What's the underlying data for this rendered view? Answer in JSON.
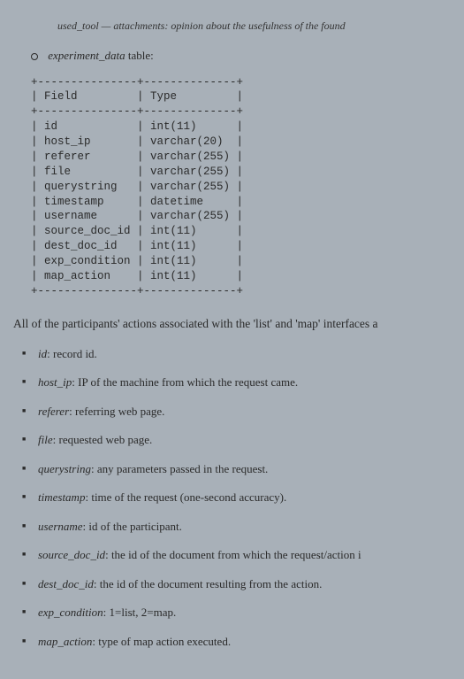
{
  "top_fragment": "used_tool — attachments: opinion about the usefulness of the found",
  "table_intro": {
    "name": "experiment_data",
    "suffix": " table:"
  },
  "schema": {
    "header": {
      "field": "Field",
      "type": "Type"
    },
    "rows": [
      {
        "field": "id",
        "type": "int(11)"
      },
      {
        "field": "host_ip",
        "type": "varchar(20)"
      },
      {
        "field": "referer",
        "type": "varchar(255)"
      },
      {
        "field": "file",
        "type": "varchar(255)"
      },
      {
        "field": "querystring",
        "type": "varchar(255)"
      },
      {
        "field": "timestamp",
        "type": "datetime"
      },
      {
        "field": "username",
        "type": "varchar(255)"
      },
      {
        "field": "source_doc_id",
        "type": "int(11)"
      },
      {
        "field": "dest_doc_id",
        "type": "int(11)"
      },
      {
        "field": "exp_condition",
        "type": "int(11)"
      },
      {
        "field": "map_action",
        "type": "int(11)"
      }
    ]
  },
  "intro_text": "All of the participants' actions associated with the 'list' and 'map' interfaces a",
  "definitions": [
    {
      "term": "id",
      "desc": "record id."
    },
    {
      "term": "host_ip",
      "desc": "IP of the machine from which the request came."
    },
    {
      "term": "referer",
      "desc": "referring web page."
    },
    {
      "term": "file",
      "desc": "requested web page."
    },
    {
      "term": "querystring",
      "desc": "any parameters passed in the request."
    },
    {
      "term": "timestamp",
      "desc": "time of the request (one-second accuracy)."
    },
    {
      "term": "username",
      "desc": "id of the participant."
    },
    {
      "term": "source_doc_id",
      "desc": "the id of the document from which the request/action i"
    },
    {
      "term": "dest_doc_id",
      "desc": "the id of the document resulting from the action."
    },
    {
      "term": "exp_condition",
      "desc": "1=list, 2=map."
    },
    {
      "term": "map_action",
      "desc": "type of map action executed."
    }
  ]
}
